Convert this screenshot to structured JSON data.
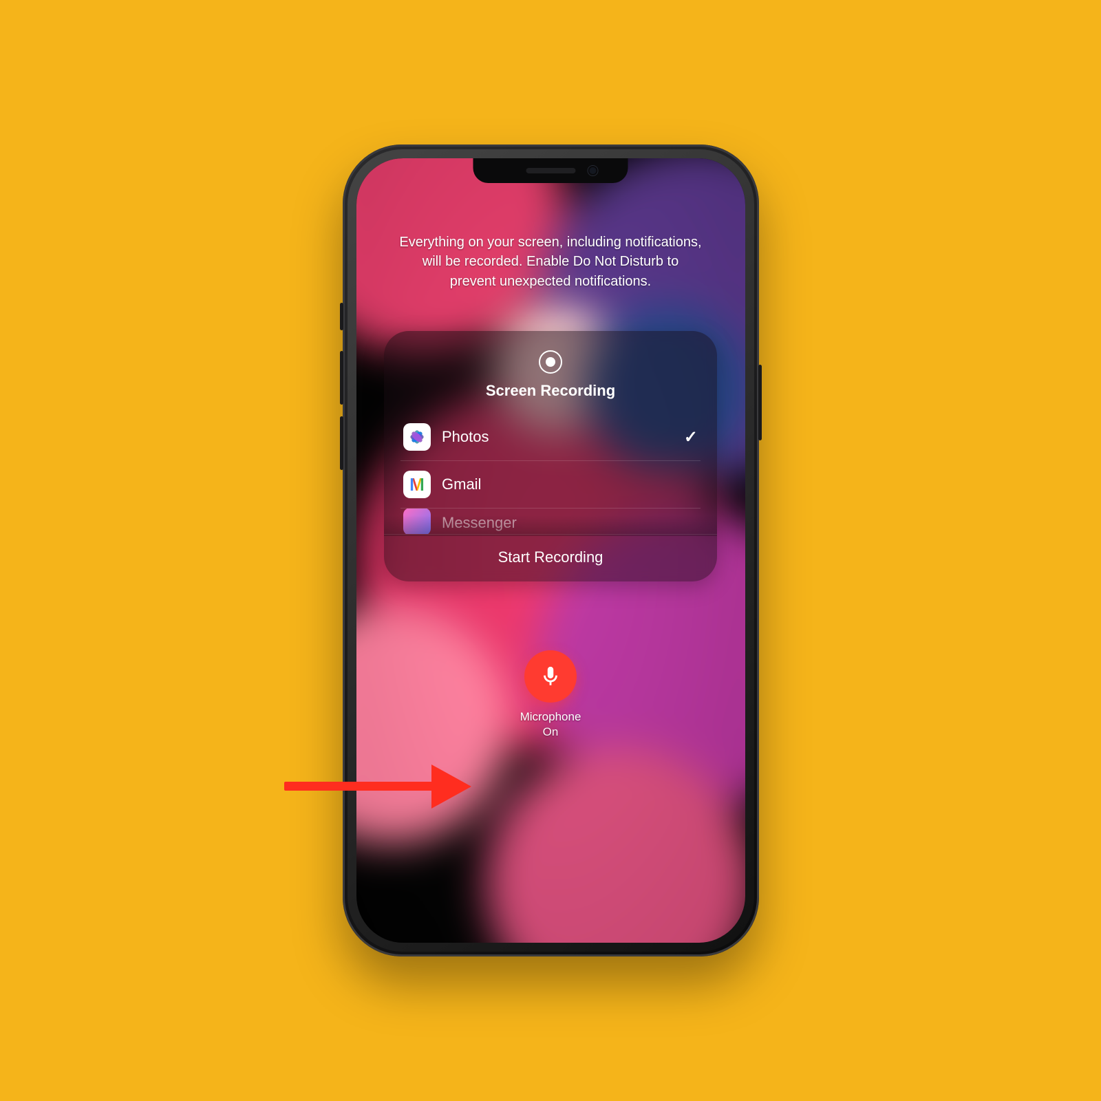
{
  "info_text": "Everything on your screen, including notifications, will be recorded. Enable Do Not Disturb to prevent unexpected notifications.",
  "panel": {
    "title": "Screen Recording",
    "start_label": "Start Recording",
    "apps": [
      {
        "name": "Photos",
        "icon": "photos-icon",
        "selected": true
      },
      {
        "name": "Gmail",
        "icon": "gmail-icon",
        "selected": false
      },
      {
        "name": "Messenger",
        "icon": "messenger-icon",
        "selected": false
      }
    ]
  },
  "microphone": {
    "label": "Microphone",
    "status": "On"
  },
  "colors": {
    "background": "#f5b41a",
    "accent_red": "#ff3b30",
    "arrow": "#ff2d1f"
  }
}
